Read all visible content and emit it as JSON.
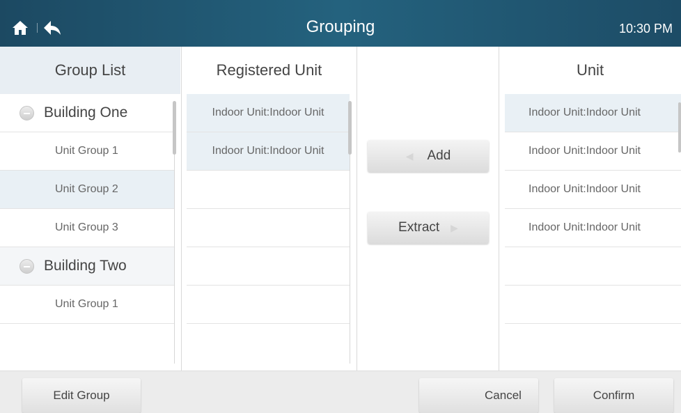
{
  "header": {
    "title": "Grouping",
    "time": "10:30 PM",
    "icons": [
      "home-icon",
      "back-icon"
    ]
  },
  "group_list": {
    "title": "Group List",
    "rows": [
      {
        "type": "building",
        "label": "Building One",
        "icon": "minus-circle-icon"
      },
      {
        "type": "group",
        "label": "Unit Group 1"
      },
      {
        "type": "group",
        "label": "Unit Group 2",
        "selected": true
      },
      {
        "type": "group",
        "label": "Unit Group 3"
      },
      {
        "type": "building",
        "label": "Building Two",
        "icon": "minus-circle-icon"
      },
      {
        "type": "group",
        "label": "Unit Group 1"
      }
    ]
  },
  "registered": {
    "title": "Registered Unit",
    "rows": [
      "Indoor Unit:Indoor Unit",
      "Indoor Unit:Indoor Unit"
    ]
  },
  "actions": {
    "add_label": "Add",
    "extract_label": "Extract"
  },
  "unit": {
    "title": "Unit",
    "rows": [
      "Indoor Unit:Indoor Unit",
      "Indoor Unit:Indoor Unit",
      "Indoor Unit:Indoor Unit",
      "Indoor Unit:Indoor Unit"
    ]
  },
  "footer": {
    "edit_group_label": "Edit Group",
    "cancel_label": "Cancel",
    "confirm_label": "Confirm"
  },
  "colors": {
    "header_bg": "#24627e",
    "selected_row": "#e9f0f5",
    "footer_bg": "#ececec"
  }
}
